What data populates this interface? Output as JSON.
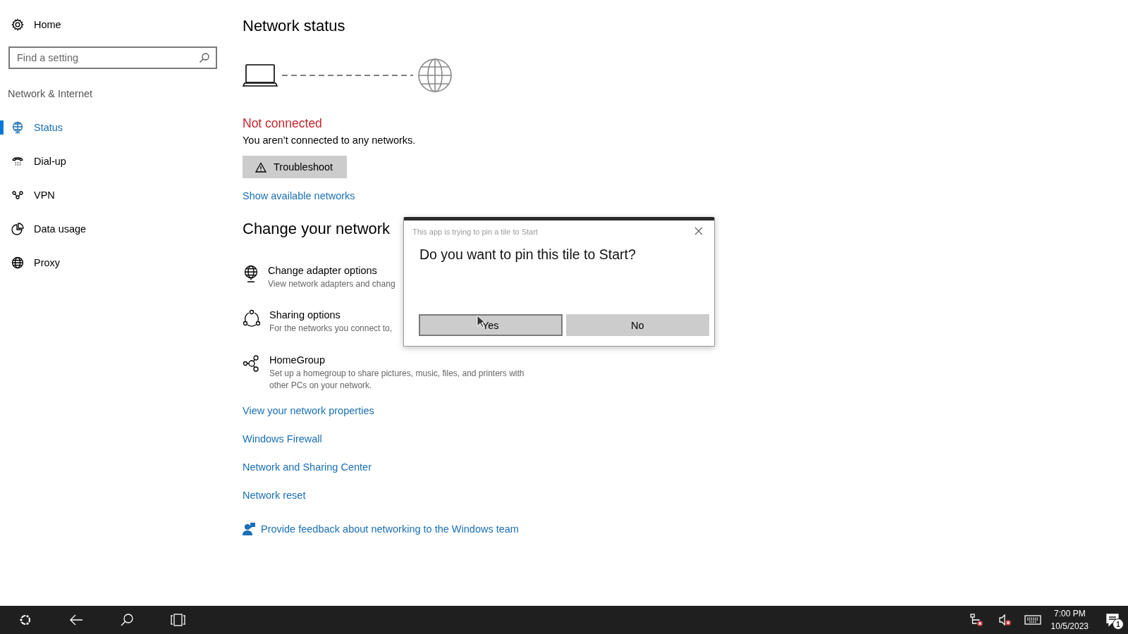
{
  "sidebar": {
    "home": "Home",
    "search": {
      "placeholder": "Find a setting"
    },
    "section": "Network & Internet",
    "items": [
      {
        "label": "Status",
        "kind": "status",
        "selected": true
      },
      {
        "label": "Dial-up",
        "kind": "dialup",
        "selected": false
      },
      {
        "label": "VPN",
        "kind": "vpn",
        "selected": false
      },
      {
        "label": "Data usage",
        "kind": "usage",
        "selected": false
      },
      {
        "label": "Proxy",
        "kind": "proxy",
        "selected": false
      }
    ]
  },
  "main": {
    "title": "Network status",
    "status": "Not connected",
    "message": "You aren’t connected to any networks.",
    "troubleshoot": "Troubleshoot",
    "show_networks": "Show available networks",
    "change_heading": "Change your network",
    "options": [
      {
        "kind": "adapter",
        "title": "Change adapter options",
        "description": "View network adapters and chang"
      },
      {
        "kind": "sharing",
        "title": "Sharing options",
        "description": "For the networks you connect to,"
      },
      {
        "kind": "homegroup",
        "title": "HomeGroup",
        "description": "Set up a homegroup to share pictures, music, files, and printers with other PCs on your network."
      }
    ],
    "links": [
      "View your network properties",
      "Windows Firewall",
      "Network and Sharing Center",
      "Network reset"
    ],
    "feedback": "Provide feedback about networking to the Windows team"
  },
  "dialog": {
    "caption": "This app is trying to pin a tile to Start",
    "question": "Do you want to pin this tile to Start?",
    "buttons": [
      {
        "label": "Yes",
        "selected": true
      },
      {
        "label": "No",
        "selected": false
      }
    ]
  },
  "taskbar": {
    "time": "7:00 PM",
    "date": "10/5/2023",
    "notification_count": "1"
  }
}
